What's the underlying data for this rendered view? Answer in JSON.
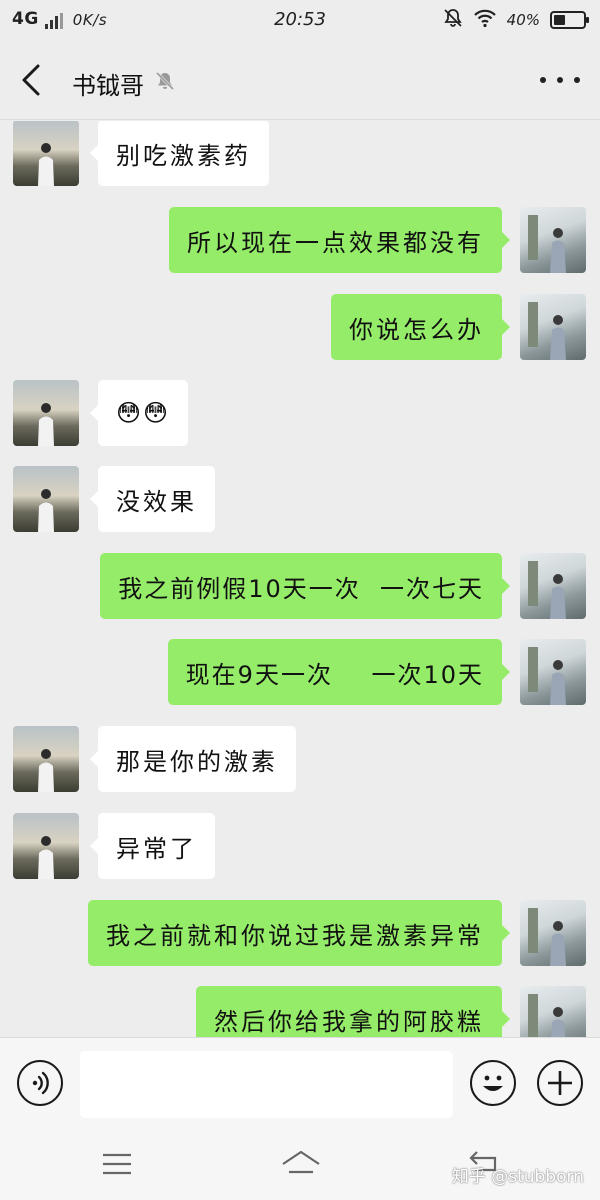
{
  "status_bar": {
    "network": "4G",
    "speed": "0K/s",
    "time": "20:53",
    "battery_text": "40%",
    "battery_level": 0.4,
    "icons": [
      "signal-icon",
      "mute-icon",
      "wifi-icon",
      "battery-icon"
    ]
  },
  "header": {
    "title": "书钺哥",
    "icons": [
      "back-arrow-icon",
      "mute-bell-icon",
      "more-icon"
    ]
  },
  "messages": [
    {
      "side": "in",
      "text": "别吃激素药"
    },
    {
      "side": "out",
      "text": "所以现在一点效果都没有"
    },
    {
      "side": "out",
      "text": "你说怎么办"
    },
    {
      "side": "in",
      "text": "😳😳"
    },
    {
      "side": "in",
      "text": "没效果"
    },
    {
      "side": "out",
      "text": "我之前例假10天一次  一次七天"
    },
    {
      "side": "out",
      "text": "现在9天一次    一次10天"
    },
    {
      "side": "in",
      "text": "那是你的激素"
    },
    {
      "side": "in",
      "text": "异常了"
    },
    {
      "side": "out",
      "text": "我之前就和你说过我是激素异常"
    },
    {
      "side": "out",
      "text": "然后你给我拿的阿胶糕"
    }
  ],
  "input_bar": {
    "value": "",
    "icons": [
      "voice-icon",
      "emoji-icon",
      "plus-icon"
    ]
  },
  "nav_bar": {
    "icons": [
      "menu-icon",
      "home-icon",
      "back-nav-icon"
    ]
  },
  "watermark": "知乎 @stubborn",
  "colors": {
    "background": "#ededed",
    "outgoing_bubble": "#95ec69",
    "incoming_bubble": "#ffffff"
  }
}
